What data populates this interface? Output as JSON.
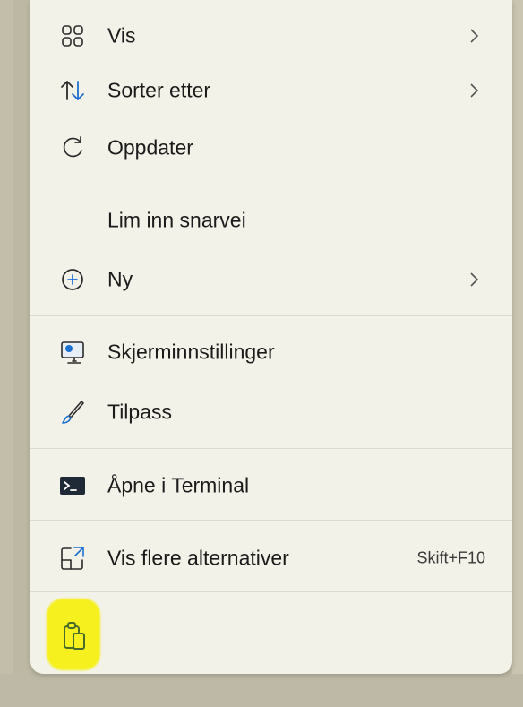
{
  "menu": {
    "items": [
      {
        "label": "Vis",
        "icon": "grid-view-icon",
        "submenu": true
      },
      {
        "label": "Sorter etter",
        "icon": "sort-arrows-icon",
        "submenu": true
      },
      {
        "label": "Oppdater",
        "icon": "refresh-icon",
        "submenu": false
      },
      {
        "label": "Lim inn snarvei",
        "icon": "",
        "submenu": false
      },
      {
        "label": "Ny",
        "icon": "plus-circle-icon",
        "submenu": true
      },
      {
        "label": "Skjerminnstillinger",
        "icon": "display-settings-icon",
        "submenu": false
      },
      {
        "label": "Tilpass",
        "icon": "brush-icon",
        "submenu": false
      },
      {
        "label": "Åpne i Terminal",
        "icon": "terminal-icon",
        "submenu": false
      },
      {
        "label": "Vis flere alternativer",
        "icon": "expand-options-icon",
        "submenu": false,
        "shortcut": "Skift+F10"
      }
    ],
    "bottom_icon": "clipboard-paste-icon"
  },
  "colors": {
    "menu_background": "#f3f2e8",
    "highlight": "#f5f01e",
    "icon_accent": "#1b6fd0"
  }
}
